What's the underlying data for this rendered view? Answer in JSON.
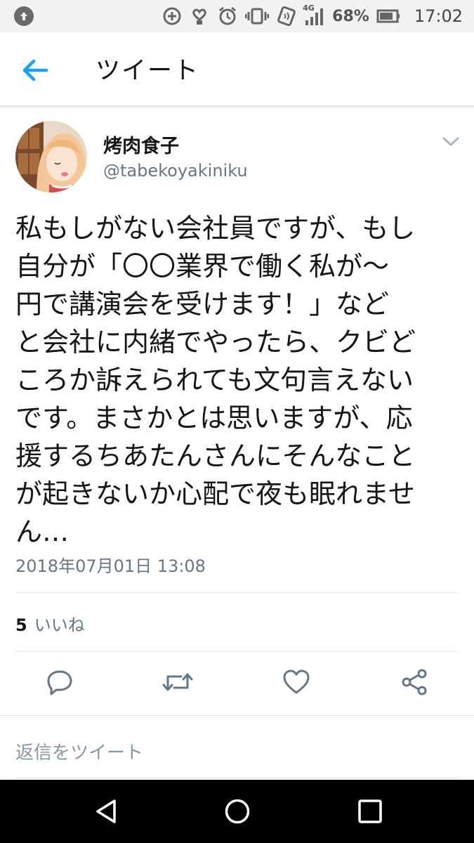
{
  "status_bar": {
    "battery": "68%",
    "time": "17:02",
    "network": "4G",
    "icons": [
      "upload-icon",
      "data-saver-icon",
      "heart-hand-icon",
      "alarm-icon",
      "vibrate-icon",
      "nfc-icon",
      "signal-icon",
      "battery-icon"
    ]
  },
  "header": {
    "title": "ツイート",
    "back_icon": "back-arrow-icon"
  },
  "tweet": {
    "author_name": "烤肉食子",
    "author_handle": "@tabekoyakiniku",
    "text": "私もしがない会社員ですが、もし\n自分が「〇〇業界で働く私が〜\n円で講演会を受けます！」など\nと会社に内緒でやったら、クビど\nころか訴えられても文句言えない\nです。まさかとは思いますが、応\n援するちあたんさんにそんなこと\nが起きないか心配で夜も眠れませ\nん…",
    "timestamp": "2018年07月01日 13:08",
    "likes_count": "5",
    "likes_label": "いいね"
  },
  "actions": [
    "reply-icon",
    "retweet-icon",
    "like-icon",
    "share-icon"
  ],
  "reply": {
    "placeholder": "返信をツイート"
  },
  "nav": [
    "back-triangle-icon",
    "home-circle-icon",
    "recents-square-icon"
  ],
  "colors": {
    "accent": "#1da1f2",
    "secondary_text": "#657786",
    "icon_gray": "#657786",
    "status_bar_bg": "#f2f2f2",
    "nav_bg": "#000000"
  }
}
